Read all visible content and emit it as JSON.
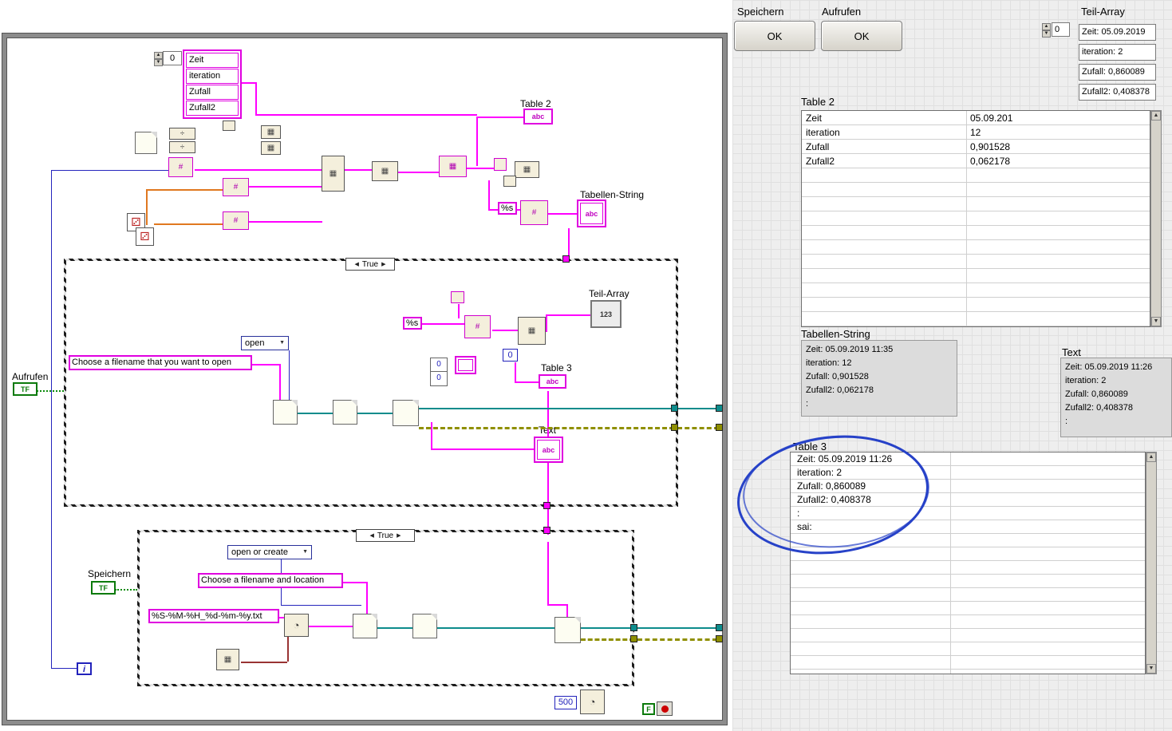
{
  "icons": {
    "abc": "abc",
    "num123": "123",
    "grid": "▦",
    "hash": "#",
    "divide": "÷",
    "dice": "⚂",
    "clock": "◔",
    "arrow_up": "▲",
    "arrow_down": "▼",
    "arrow_left": "◀",
    "arrow_right": "▶",
    "spin_up": "▲",
    "spin_down": "▼"
  },
  "diagram": {
    "array_index": "0",
    "cluster": {
      "items": [
        "Zeit",
        "iteration",
        "Zufall",
        "Zufall2"
      ]
    },
    "table2_label": "Table 2",
    "tabellen_label": "Tabellen-String",
    "format_s_top": "%s",
    "case1": {
      "selector": "True",
      "mode": "open",
      "prompt": "Choose  a filename that you want to open",
      "format_s": "%s",
      "zero1": "0",
      "zero2": "0",
      "zero3": "0",
      "teil_label": "Teil-Array",
      "table3_label": "Table 3",
      "text_label": "Text"
    },
    "case2": {
      "selector": "True",
      "mode": "open or create",
      "prompt": "Choose  a filename and location",
      "pattern": "%S-%M-%H_%d-%m-%y.txt"
    },
    "aufrufen_label": "Aufrufen",
    "speichern_label": "Speichern",
    "tf": "TF",
    "loop_i": "i",
    "wait_ms": "500",
    "shift_f": "F"
  },
  "panel": {
    "speichern_label": "Speichern",
    "aufrufen_label": "Aufrufen",
    "ok": "OK",
    "teil_array": {
      "label": "Teil-Array",
      "index": "0",
      "items": [
        "Zeit: 05.09.2019",
        "iteration: 2",
        "Zufall: 0,860089",
        "Zufall2: 0,408378"
      ]
    },
    "table2": {
      "label": "Table 2",
      "rows": [
        [
          "Zeit",
          "05.09.201"
        ],
        [
          "iteration",
          "12"
        ],
        [
          "Zufall",
          "0,901528"
        ],
        [
          "Zufall2",
          "0,062178"
        ]
      ]
    },
    "tabellen_string": {
      "label": "Tabellen-String",
      "lines": [
        "Zeit: 05.09.2019 11:35",
        "iteration: 12",
        "Zufall: 0,901528",
        "Zufall2: 0,062178",
        ":"
      ]
    },
    "text": {
      "label": "Text",
      "lines": [
        "Zeit: 05.09.2019 11:26",
        "iteration: 2",
        "Zufall: 0,860089",
        "Zufall2: 0,408378",
        ":"
      ]
    },
    "table3": {
      "label": "Table 3",
      "rows": [
        "Zeit: 05.09.2019 11:26",
        "iteration: 2",
        "Zufall: 0,860089",
        "Zufall2: 0,408378",
        ":",
        "sai:"
      ]
    }
  }
}
